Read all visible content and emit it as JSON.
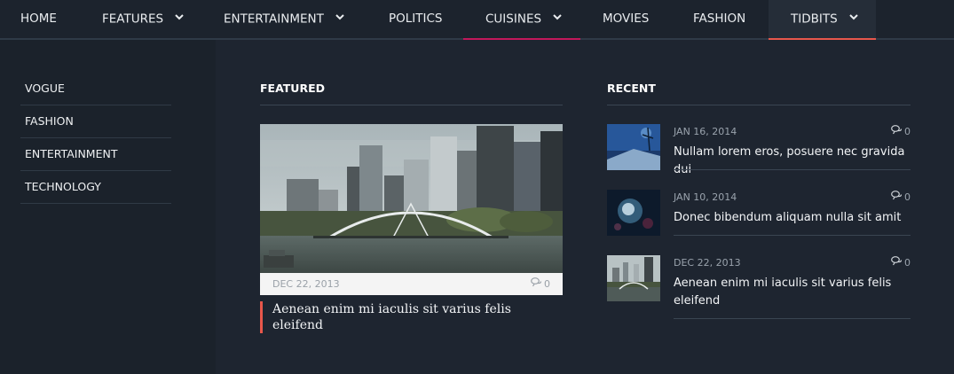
{
  "nav": {
    "items": [
      {
        "label": "HOME",
        "has_dropdown": false
      },
      {
        "label": "FEATURES",
        "has_dropdown": true
      },
      {
        "label": "ENTERTAINMENT",
        "has_dropdown": true
      },
      {
        "label": "POLITICS",
        "has_dropdown": false
      },
      {
        "label": "CUISINES",
        "has_dropdown": true,
        "underline_color": "#c2185b"
      },
      {
        "label": "MOVIES",
        "has_dropdown": false
      },
      {
        "label": "FASHION",
        "has_dropdown": false
      },
      {
        "label": "TIDBITS",
        "has_dropdown": true,
        "active": true,
        "underline_color": "#e8574b"
      }
    ]
  },
  "sidebar": {
    "items": [
      {
        "label": "VOGUE"
      },
      {
        "label": "FASHION"
      },
      {
        "label": "ENTERTAINMENT"
      },
      {
        "label": "TECHNOLOGY"
      }
    ]
  },
  "featured": {
    "heading": "FEATURED",
    "post": {
      "date": "DEC 22, 2013",
      "comments": "0",
      "title": "Aenean enim mi iaculis sit varius felis eleifend"
    }
  },
  "recent": {
    "heading": "RECENT",
    "posts": [
      {
        "date": "JAN 16, 2014",
        "comments": "0",
        "title": "Nullam lorem eros, posuere nec gravida dui"
      },
      {
        "date": "JAN 10, 2014",
        "comments": "0",
        "title": "Donec bibendum aliquam nulla sit amit"
      },
      {
        "date": "DEC 22, 2013",
        "comments": "0",
        "title": "Aenean enim mi iaculis sit varius felis eleifend"
      }
    ]
  },
  "icons": {
    "dropdown": "chevron-down-icon",
    "comments": "comments-icon"
  },
  "colors": {
    "accent_red": "#e8574b",
    "accent_magenta": "#c2185b"
  }
}
